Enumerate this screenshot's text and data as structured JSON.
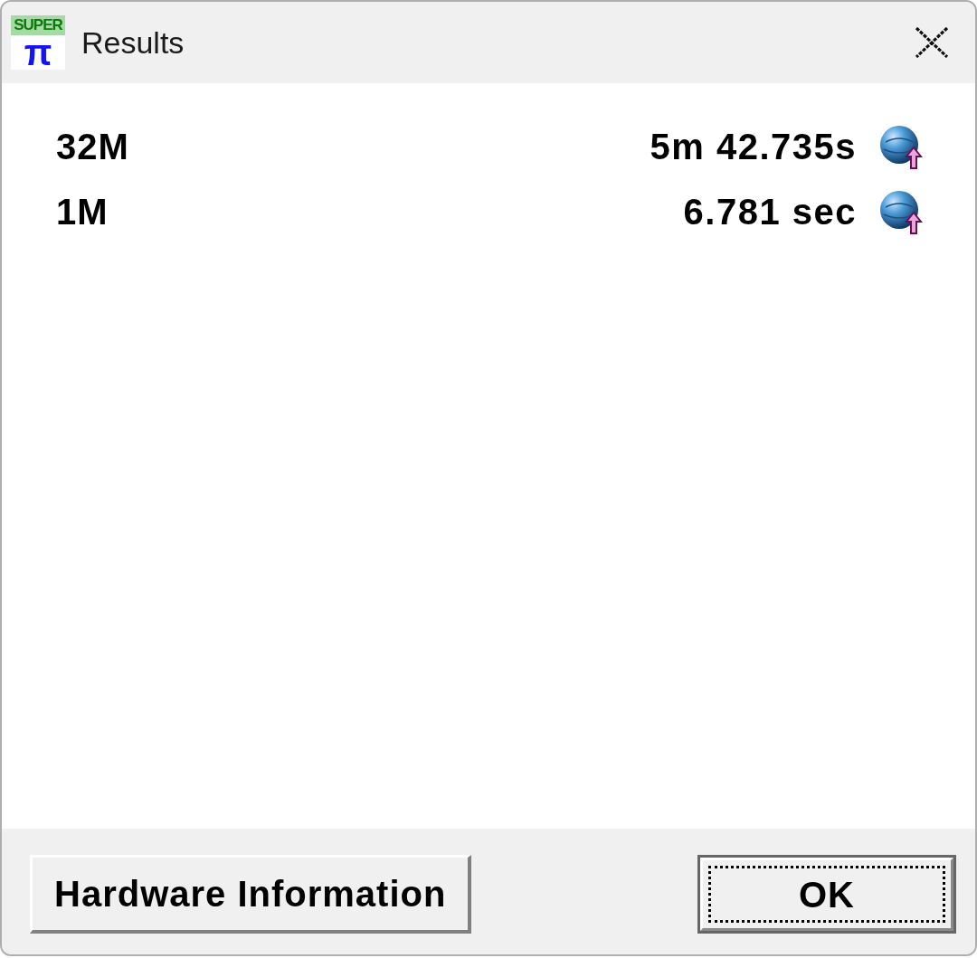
{
  "window": {
    "title": "Results",
    "logo": {
      "text": "SUPER",
      "symbol": "π"
    }
  },
  "results": [
    {
      "label": "32M",
      "time": "5m 42.735s"
    },
    {
      "label": "1M",
      "time": "6.781 sec"
    }
  ],
  "buttons": [
    {
      "label": "Hardware Information",
      "default": false
    },
    {
      "label": "OK",
      "default": true
    }
  ]
}
